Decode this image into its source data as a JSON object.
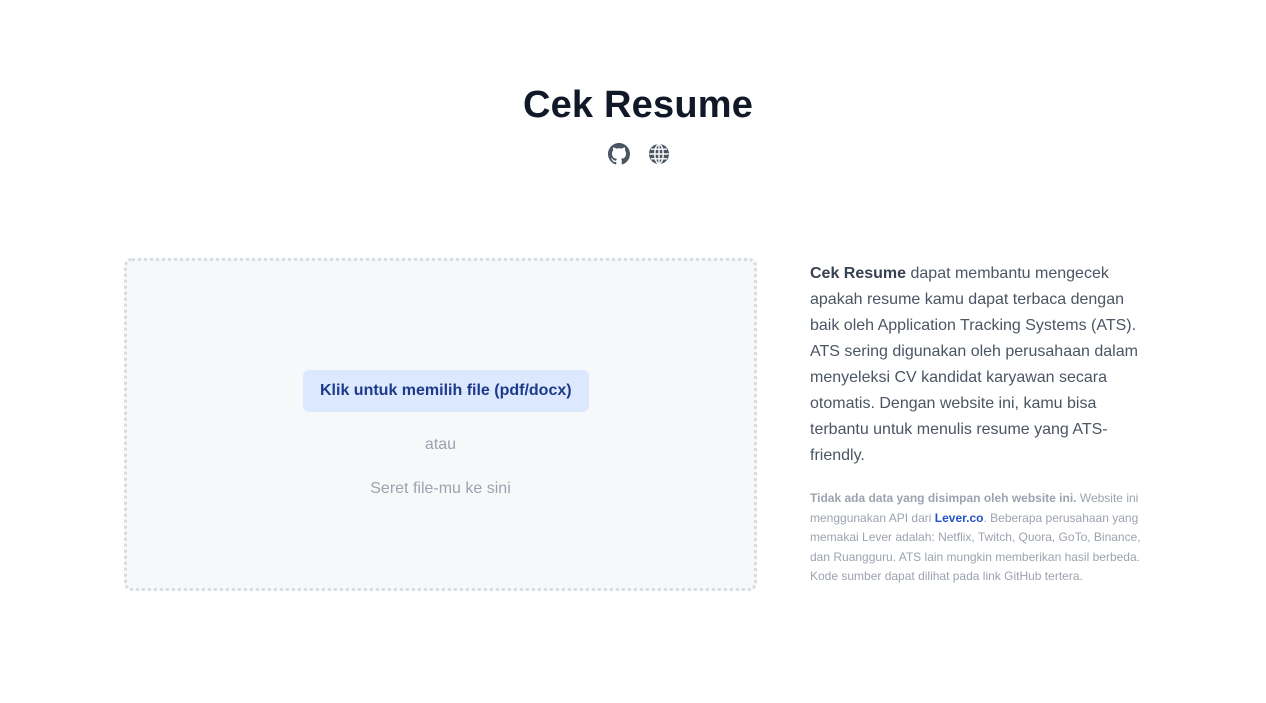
{
  "header": {
    "title": "Cek Resume",
    "icons": [
      "github-icon",
      "globe-icon"
    ]
  },
  "dropzone": {
    "button_label": "Klik untuk memilih file (pdf/docx)",
    "or_text": "atau",
    "drag_text": "Seret file-mu ke sini"
  },
  "info": {
    "brand": "Cek Resume",
    "description": " dapat membantu mengecek apakah resume kamu dapat terbaca dengan baik oleh Application Tracking Systems (ATS). ATS sering digunakan oleh perusahaan dalam menyeleksi CV kandidat karyawan secara otomatis. Dengan website ini, kamu bisa terbantu untuk menulis resume yang ATS-friendly.",
    "note_bold": "Tidak ada data yang disimpan oleh website ini.",
    "note_part1": " Website ini menggunakan API dari ",
    "note_link": "Lever.co",
    "note_part2": ". Beberapa perusahaan yang memakai Lever adalah: Netflix, Twitch, Quora, GoTo, Binance, dan Ruangguru. ATS lain mungkin memberikan hasil berbeda. Kode sumber dapat dilihat pada link GitHub tertera."
  },
  "colors": {
    "title": "#111827",
    "button_bg": "#dbe8fe",
    "button_text": "#1e3a8a",
    "link": "#2453c8",
    "muted": "#9ca3af"
  }
}
